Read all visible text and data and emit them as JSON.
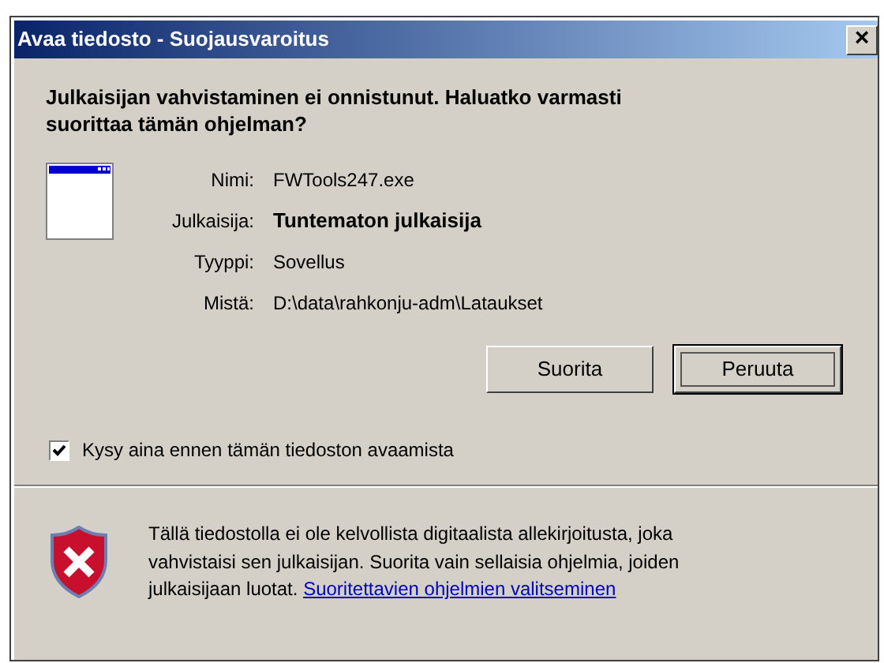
{
  "window": {
    "title": "Avaa tiedosto - Suojausvaroitus",
    "close": "×"
  },
  "heading": "Julkaisijan vahvistaminen ei onnistunut. Haluatko varmasti suorittaa tämän ohjelman?",
  "details": [
    {
      "label": "Nimi:",
      "value": "FWTools247.exe",
      "bold": false
    },
    {
      "label": "Julkaisija:",
      "value": "Tuntematon julkaisija",
      "bold": true
    },
    {
      "label": "Tyyppi:",
      "value": "Sovellus",
      "bold": false
    },
    {
      "label": "Mistä:",
      "value": "D:\\data\\rahkonju-adm\\Lataukset",
      "bold": false
    }
  ],
  "buttons": [
    {
      "label": "Suorita",
      "focused": false
    },
    {
      "label": "Peruuta",
      "focused": true
    }
  ],
  "checkbox": {
    "label": "Kysy aina ennen tämän tiedoston avaamista",
    "checked": true
  },
  "warning": {
    "text": "Tällä tiedostolla ei ole kelvollista digitaalista allekirjoitusta, joka vahvistaisi sen julkaisijan. Suorita vain sellaisia ohjelmia, joiden julkaisijaan luotat.",
    "link": "Suoritettavien ohjelmien valitseminen"
  }
}
